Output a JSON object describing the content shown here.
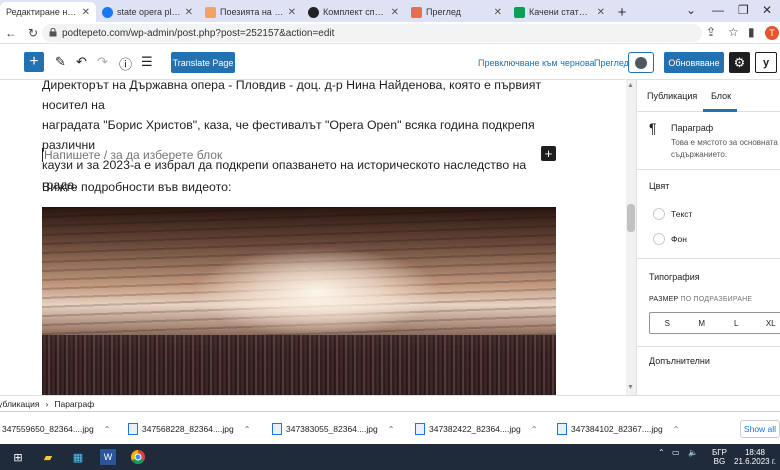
{
  "browser": {
    "tabs": [
      {
        "label": "Редактиране на публ...",
        "active": true,
        "icon_color": "#ffffff"
      },
      {
        "label": "state opera plovdiv - ...",
        "active": false,
        "icon_color": "#1877f2"
      },
      {
        "label": "Поезията на Иван Ра...",
        "active": false,
        "icon_color": "#f4a261"
      },
      {
        "label": "Комплект спално бе...",
        "active": false,
        "icon_color": "#222222"
      },
      {
        "label": "Преглед",
        "active": false,
        "icon_color": "#e76f51"
      },
      {
        "label": "Качени статии за де...",
        "active": false,
        "icon_color": "#0f9d58"
      }
    ],
    "new_tab": "+",
    "url": "podtepeto.com/wp-admin/post.php?post=252157&action=edit",
    "avatar_letter": "T"
  },
  "editor_header": {
    "translate_label": "Translate Page",
    "save_draft_label": "Превключване към чернова",
    "preview_label": "Преглед",
    "update_label": "Обновяване",
    "yoast_label": "y"
  },
  "content": {
    "paragraph_lines": [
      "Директорът на Държавна опера - Пловдив - доц. д-р Нина Найденова, която е първият носител на",
      "наградата \"Борис Христов\", каза, че фестивалът \"Opera Open\" всяка година подкрепя различни",
      "каузи и за 2023-а е избрал да подкрепи опазването на историческото наследство на града."
    ],
    "placeholder": "Напишете / за да изберете блок",
    "video_intro": "Вижте подробности във видеото:"
  },
  "sidebar": {
    "tab_post": "Публикация",
    "tab_block": "Блок",
    "block_name": "Параграф",
    "block_desc_1": "Това е мястото за основната те",
    "block_desc_2": "съдържанието.",
    "color_title": "Цвят",
    "color_text": "Текст",
    "color_background": "Фон",
    "typography_title": "Типография",
    "size_label_strong": "РАЗМЕР",
    "size_label_rest": " ПО ПОДРАЗБИРАНЕ",
    "sizes": [
      "S",
      "M",
      "L",
      "XL"
    ],
    "additional_title": "Допълнителни"
  },
  "breadcrumb": {
    "items": [
      "Публикация",
      "Параграф"
    ],
    "separator": "›"
  },
  "downloads": {
    "files": [
      "347559650_82364....jpg",
      "347568228_82364....jpg",
      "347383055_82364....jpg",
      "347382422_82364....jpg",
      "347384102_82367....jpg"
    ],
    "show_all": "Show all"
  },
  "taskbar": {
    "lang_top": "БГР",
    "lang_bottom": "BG",
    "time": "18:48",
    "date": "21.6.2023 г."
  },
  "colors": {
    "wp_blue": "#2271b1",
    "taskbar": "#1f2a3a",
    "tabstrip": "#dfe1f5"
  }
}
